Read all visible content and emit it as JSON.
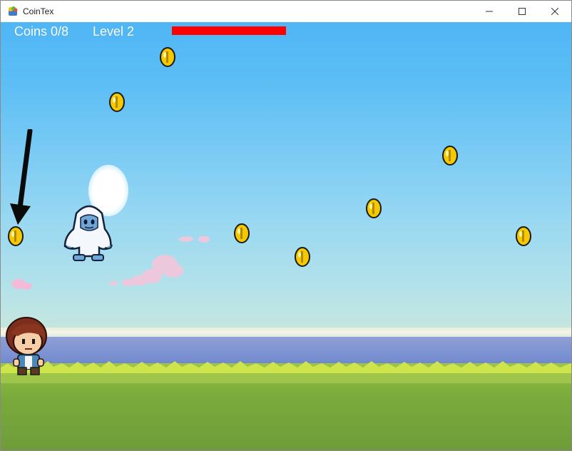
{
  "window": {
    "title": "CoinTex",
    "controls": {
      "minimize_icon": "minimize-icon",
      "maximize_icon": "maximize-icon",
      "close_icon": "close-icon"
    }
  },
  "hud": {
    "coins_label": "Coins 0/8",
    "level_label": "Level 2",
    "health_bar_color": "#ff0000",
    "health_fraction": 1.0
  },
  "scene": {
    "sky_color_top": "#4fb6f5",
    "sea_color": "#7d92d3",
    "grass_color": "#8bb840",
    "coin_color": "#f5c800",
    "coin_count_visible": 8,
    "sprites": [
      "player-character",
      "yeti-enemy",
      "sun",
      "pointer-arrow"
    ]
  }
}
